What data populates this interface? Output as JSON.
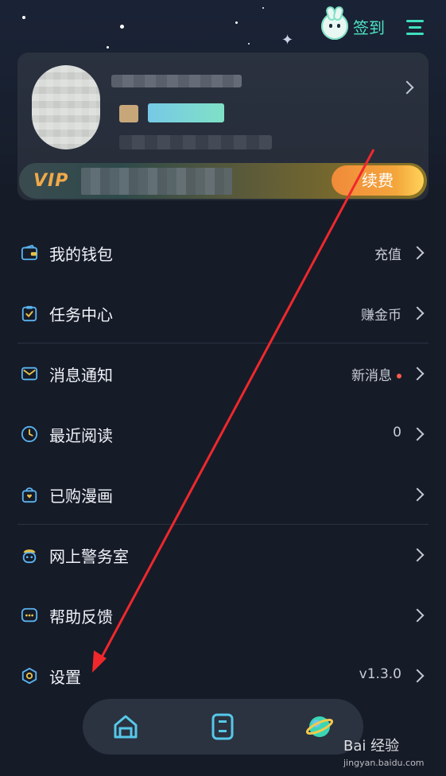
{
  "header": {
    "checkin_label": "签到",
    "icons": {
      "checkin": "bunny-icon",
      "menu": "menu-lines-icon"
    },
    "accent_color": "#3ee0c0"
  },
  "profile": {
    "vip_label": "VIP",
    "renew_label": "续费",
    "renew_color": "#f4a63c"
  },
  "menu": {
    "items": [
      {
        "label": "我的钱包",
        "value": "充值",
        "icon": "wallet-icon"
      },
      {
        "label": "任务中心",
        "value": "赚金币",
        "icon": "task-icon"
      },
      {
        "label": "消息通知",
        "value": "新消息",
        "icon": "mail-icon",
        "badge": true
      },
      {
        "label": "最近阅读",
        "value": "0",
        "icon": "clock-icon"
      },
      {
        "label": "已购漫画",
        "value": "",
        "icon": "shopping-bag-icon"
      },
      {
        "label": "网上警务室",
        "value": "",
        "icon": "police-icon"
      },
      {
        "label": "帮助反馈",
        "value": "",
        "icon": "chat-bubble-icon"
      },
      {
        "label": "设置",
        "value": "v1.3.0",
        "icon": "settings-hexagon-icon"
      }
    ]
  },
  "bottom_nav": {
    "items": [
      {
        "icon": "home-icon"
      },
      {
        "icon": "bookshelf-icon"
      },
      {
        "icon": "planet-icon"
      }
    ]
  },
  "watermark": {
    "text": "Bai 经验",
    "sub": "jingyan.baidu.com"
  }
}
